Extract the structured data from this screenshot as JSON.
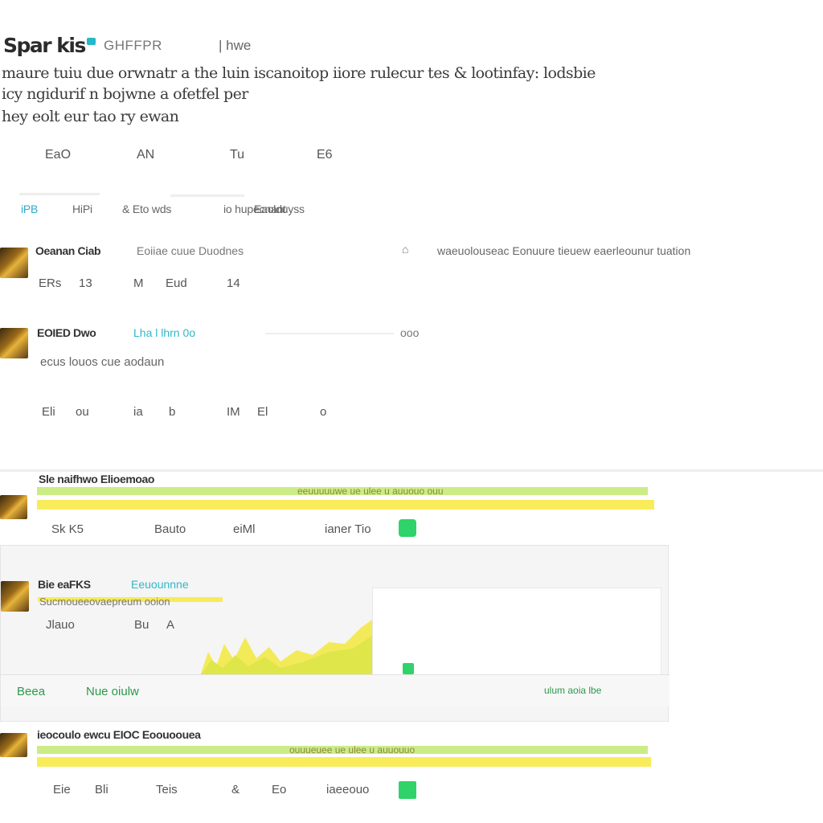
{
  "header": {
    "name": "Spar kis",
    "handle": "GHFFPR",
    "suffix": "| hwe"
  },
  "bio": {
    "line1": "maure tuiu due orwnatr a the luin iscanoitop iiore rulecur tes & lootinfay: lodsbie",
    "line2": "icy ngidurif n bojwne a ofetfel per",
    "line3": "hey eolt eur tao ry ewan"
  },
  "stats": [
    "EaO",
    "AN",
    "Tu",
    "E6"
  ],
  "tabs": [
    "iPB",
    "HiPi",
    "& Eto wds",
    "io hupecnant",
    "Eaolduyss"
  ],
  "posts": [
    {
      "name": "Oeanan Ciab",
      "meta": "Eoiiae cuue Duodnes",
      "right_text": "waeuolouseac Eonuure tieuew eaerleounur tuation",
      "actions": [
        "ERs",
        "13",
        "M",
        "Eud",
        "14"
      ]
    },
    {
      "name": "EOIED Dwo",
      "meta": "Lha l lhrn 0o",
      "side_meta": "ooo",
      "text": "ecus louos cue aodaun",
      "actions": [
        "Eli",
        "ou",
        "ia",
        "b",
        "IM",
        "El",
        "o"
      ]
    },
    {
      "name": "Sle naifhwo Elioemoao",
      "highlight": "eeuuuuuwe ue ulee u auuouo ouu",
      "actions": [
        "Sk K5",
        "Bauto",
        "eiMl",
        "ianer Tio"
      ]
    },
    {
      "name": "Bie eaFKS",
      "meta": "Eeuounnne",
      "subline": "Sucmoueeovaepreum ooion",
      "actions": [
        "Jlauo",
        "Bu",
        "A"
      ],
      "footer_left": "Beea",
      "footer_mid": "Nue oiulw",
      "footer_right": "ulum aoia lbe"
    },
    {
      "name": "ieocoulo ewcu EIOC Eoouoouea",
      "highlight": "ouuueuee ue ulee u auuouuo",
      "actions": [
        "Eie",
        "Bli",
        "Teis",
        "&",
        "Eo",
        "iaeeouo"
      ]
    }
  ],
  "colors": {
    "accent": "#2faac9",
    "green": "#2fd36a",
    "yellow": "#f8ea48"
  }
}
